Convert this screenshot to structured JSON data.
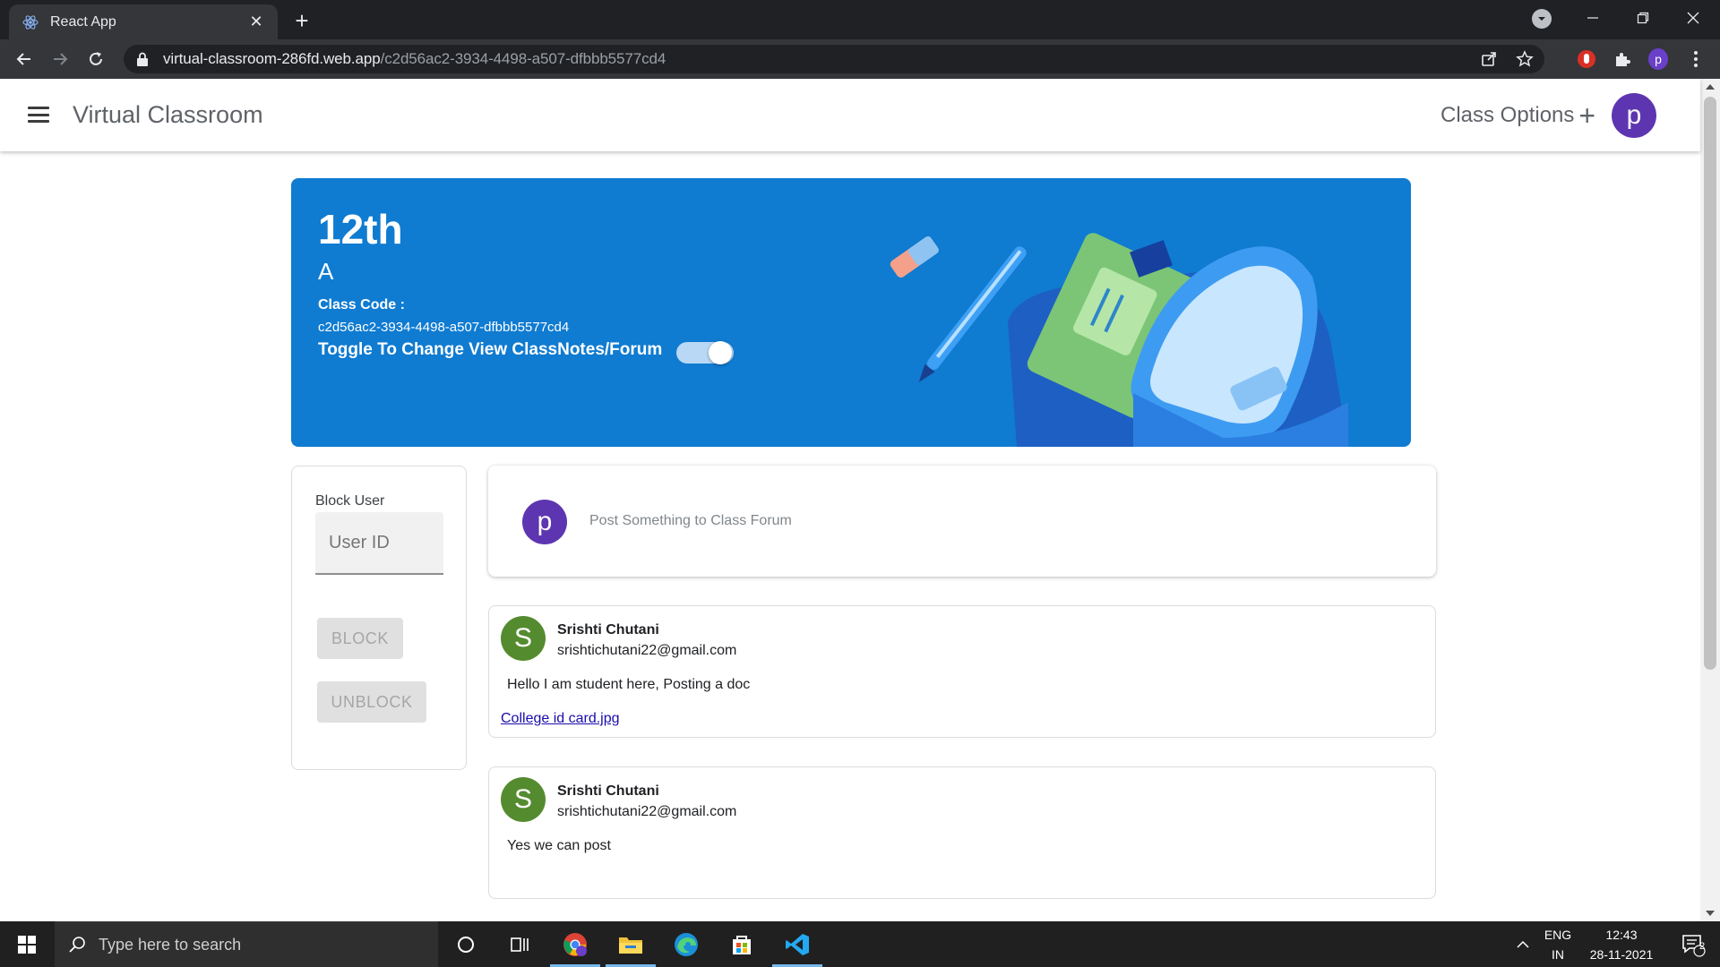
{
  "browser": {
    "tab_title": "React App",
    "url_host": "virtual-classroom-286fd.web.app",
    "url_path": "/c2d56ac2-3934-4498-a507-dfbbb5577cd4",
    "profile_initial": "p"
  },
  "app": {
    "title": "Virtual Classroom",
    "class_options_label": "Class Options",
    "class_options_plus": "+",
    "user_initial": "p"
  },
  "banner": {
    "grade": "12th",
    "section": "A",
    "class_code_label": "Class Code :",
    "class_code": "c2d56ac2-3934-4498-a507-dfbbb5577cd4",
    "toggle_label": "Toggle To Change View ClassNotes/Forum",
    "toggle_on": true,
    "color": "#0f7bd1"
  },
  "block_panel": {
    "title": "Block User",
    "input_placeholder": "User ID",
    "input_value": "",
    "block_label": "BLOCK",
    "unblock_label": "UNBLOCK"
  },
  "post_box": {
    "avatar_initial": "p",
    "placeholder": "Post Something to Class Forum"
  },
  "announcements": [
    {
      "avatar_initial": "S",
      "name": "Srishti Chutani",
      "email": "srishtichutani22@gmail.com",
      "text": "Hello I am student here, Posting a doc",
      "attachment": "College id card.jpg"
    },
    {
      "avatar_initial": "S",
      "name": "Srishti Chutani",
      "email": "srishtichutani22@gmail.com",
      "text": "Yes we can post"
    }
  ],
  "taskbar": {
    "search_placeholder": "Type here to search",
    "lang_line1": "ENG",
    "lang_line2": "IN",
    "time": "12:43",
    "date": "28-11-2021",
    "notification_count": "2"
  },
  "colors": {
    "accent_purple": "#5e35b1",
    "avatar_green": "#558b2f",
    "link": "#1a0dab"
  }
}
